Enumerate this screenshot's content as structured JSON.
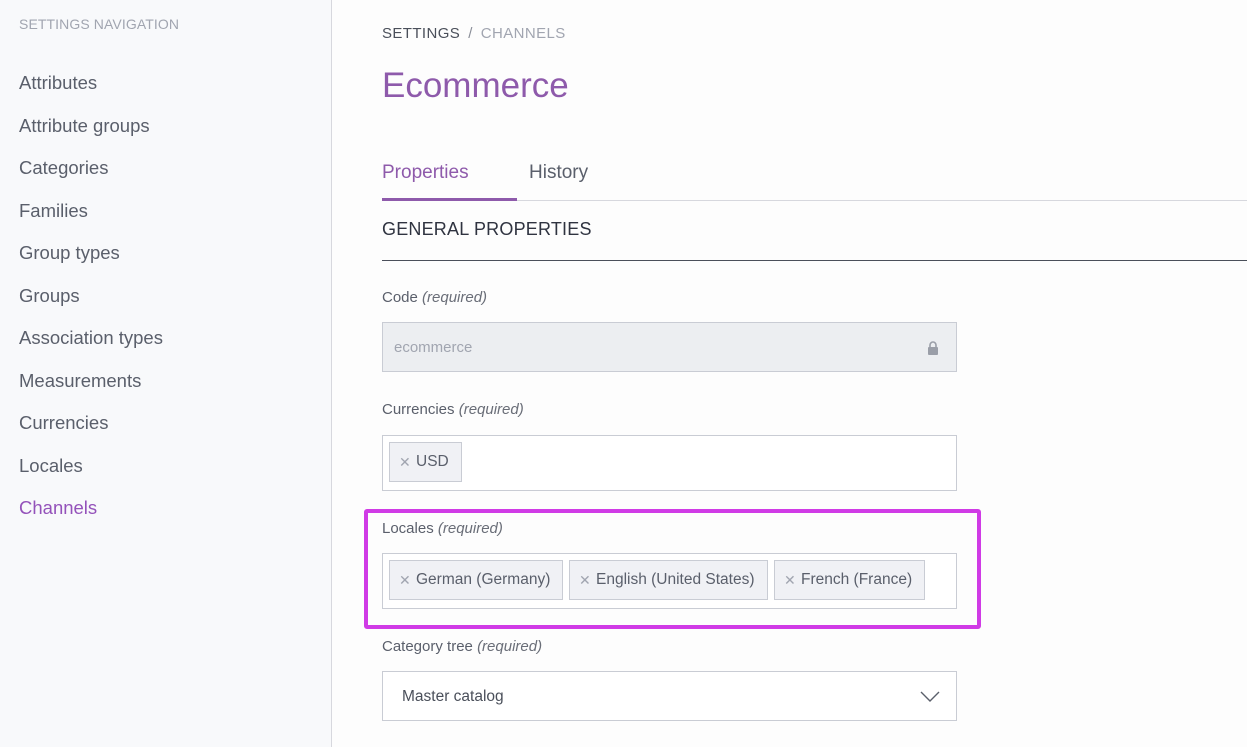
{
  "sidebar": {
    "heading": "SETTINGS NAVIGATION",
    "items": [
      {
        "label": "Attributes"
      },
      {
        "label": "Attribute groups"
      },
      {
        "label": "Categories"
      },
      {
        "label": "Families"
      },
      {
        "label": "Group types"
      },
      {
        "label": "Groups"
      },
      {
        "label": "Association types"
      },
      {
        "label": "Measurements"
      },
      {
        "label": "Currencies"
      },
      {
        "label": "Locales"
      },
      {
        "label": "Channels"
      }
    ],
    "active_item": "Channels"
  },
  "breadcrumb": {
    "settings": "SETTINGS",
    "separator": "/",
    "current": "CHANNELS"
  },
  "page": {
    "title": "Ecommerce"
  },
  "tabs": {
    "properties": "Properties",
    "history": "History"
  },
  "section": {
    "title": "GENERAL PROPERTIES"
  },
  "fields": {
    "code": {
      "label": "Code",
      "required": "(required)",
      "value": "ecommerce",
      "icon": "lock-icon"
    },
    "currencies": {
      "label": "Currencies",
      "required": "(required)",
      "tags": [
        "USD"
      ]
    },
    "locales": {
      "label": "Locales",
      "required": "(required)",
      "tags": [
        "German (Germany)",
        "English (United States)",
        "French (France)"
      ]
    },
    "category_tree": {
      "label": "Category tree",
      "required": "(required)",
      "value": "Master catalog",
      "icon": "chevron-down-icon"
    }
  },
  "colors": {
    "accent": "#8e5aab",
    "highlight": "#d03be6"
  }
}
